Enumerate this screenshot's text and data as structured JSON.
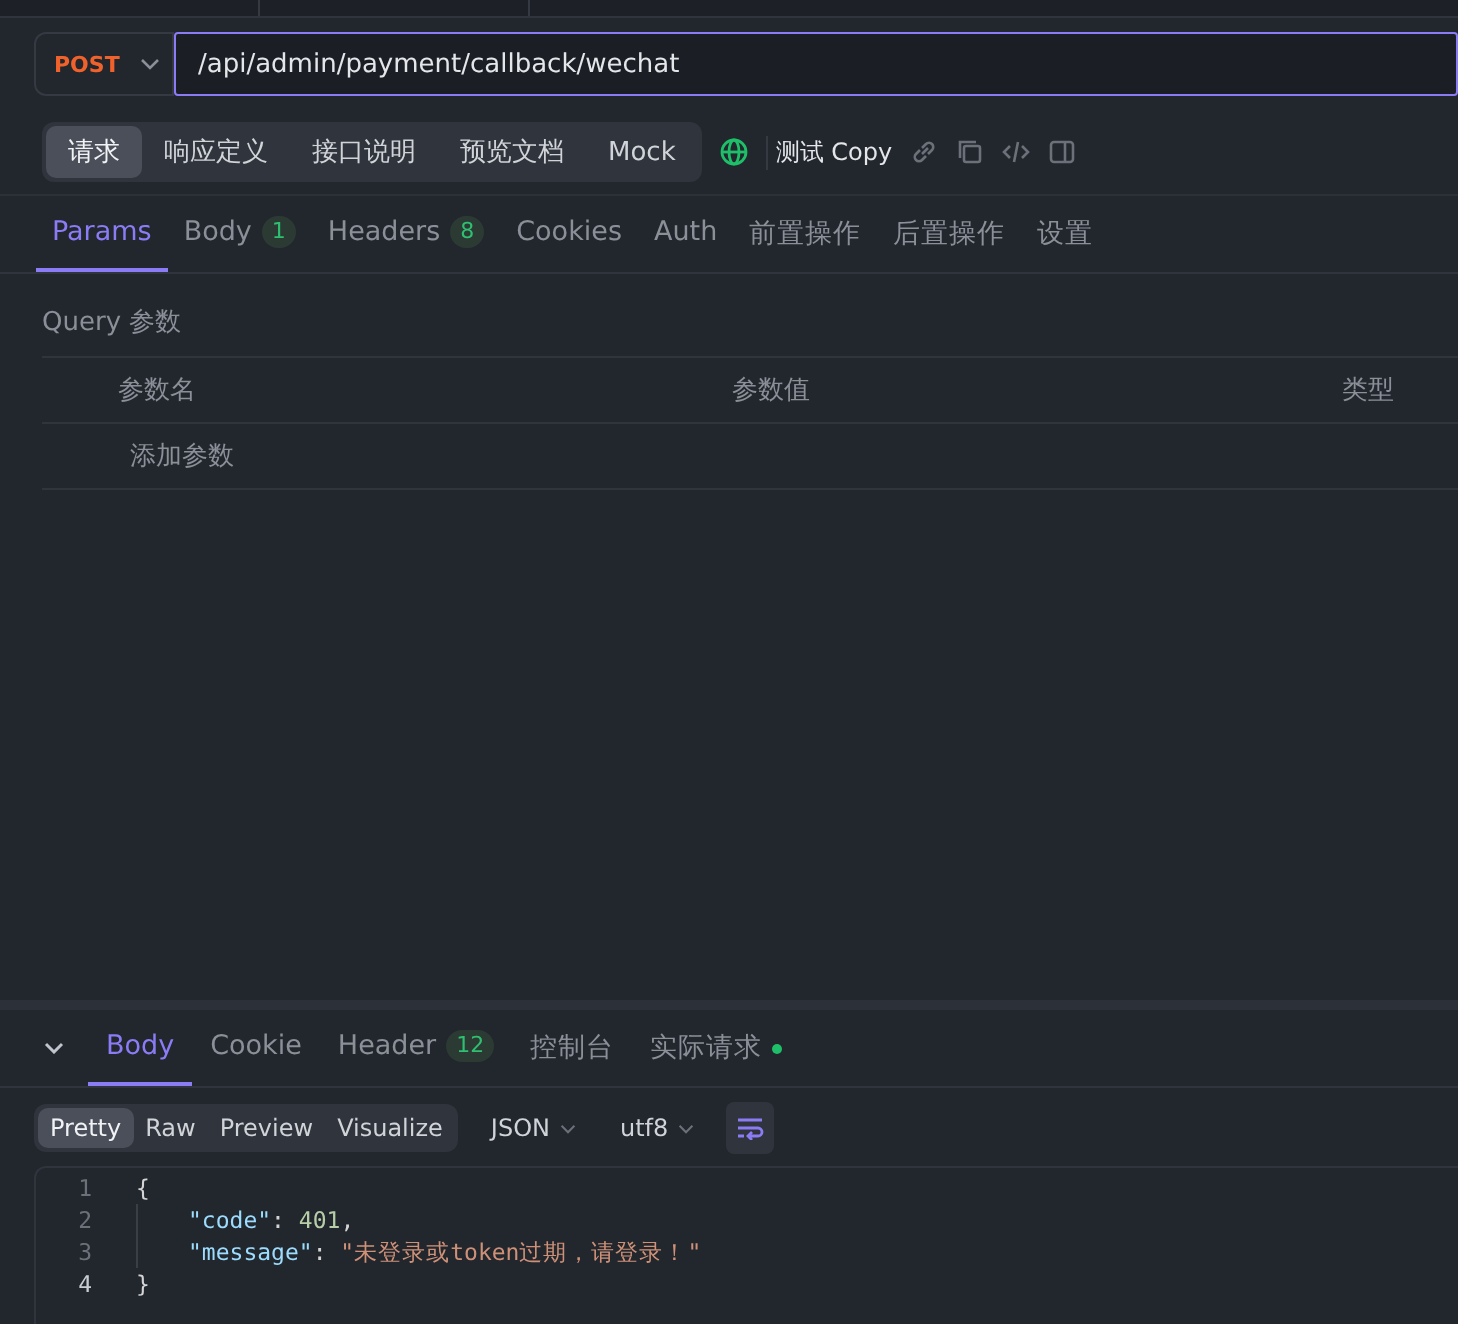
{
  "request": {
    "method": "POST",
    "url": "/api/admin/payment/callback/wechat"
  },
  "doc_tabs": [
    {
      "label": "请求",
      "selected": true
    },
    {
      "label": "响应定义",
      "selected": false
    },
    {
      "label": "接口说明",
      "selected": false
    },
    {
      "label": "预览文档",
      "selected": false
    },
    {
      "label": "Mock",
      "selected": false
    }
  ],
  "environment": {
    "label": "测试 Copy"
  },
  "request_tabs": [
    {
      "label": "Params",
      "selected": true
    },
    {
      "label": "Body",
      "badge": "1",
      "selected": false
    },
    {
      "label": "Headers",
      "badge": "8",
      "selected": false
    },
    {
      "label": "Cookies",
      "selected": false
    },
    {
      "label": "Auth",
      "selected": false
    },
    {
      "label": "前置操作",
      "selected": false
    },
    {
      "label": "后置操作",
      "selected": false
    },
    {
      "label": "设置",
      "selected": false
    }
  ],
  "query": {
    "title": "Query 参数",
    "columns": [
      "参数名",
      "参数值",
      "类型"
    ],
    "placeholder": "添加参数"
  },
  "response": {
    "expanded": true,
    "tabs": [
      {
        "label": "Body",
        "selected": true
      },
      {
        "label": "Cookie",
        "selected": false
      },
      {
        "label": "Header",
        "badge": "12",
        "selected": false
      },
      {
        "label": "控制台",
        "selected": false
      },
      {
        "label": "实际请求",
        "selected": false,
        "color": "#1fbf6a"
      }
    ],
    "view_modes": [
      {
        "label": "Pretty",
        "selected": true
      },
      {
        "label": "Raw",
        "selected": false
      },
      {
        "label": "Preview",
        "selected": false
      },
      {
        "label": "Visualize",
        "selected": false
      }
    ],
    "format": "JSON",
    "encoding": "utf8",
    "word_wrap": true,
    "lines": [
      {
        "number": "1",
        "current": false,
        "tokens": [
          {
            "kind": "punct",
            "text": "{"
          }
        ]
      },
      {
        "number": "2",
        "current": false,
        "tokens": [
          {
            "kind": "key",
            "text": "\"code\""
          },
          {
            "kind": "punct",
            "text": ": "
          },
          {
            "kind": "number",
            "text": "401"
          },
          {
            "kind": "punct",
            "text": ","
          }
        ]
      },
      {
        "number": "3",
        "current": false,
        "tokens": [
          {
            "kind": "key",
            "text": "\"message\""
          },
          {
            "kind": "punct",
            "text": ": "
          },
          {
            "kind": "string",
            "text": "\"未登录或token过期，请登录！\""
          }
        ]
      },
      {
        "number": "4",
        "current": true,
        "tokens": [
          {
            "kind": "punct",
            "text": "}"
          }
        ]
      }
    ]
  }
}
